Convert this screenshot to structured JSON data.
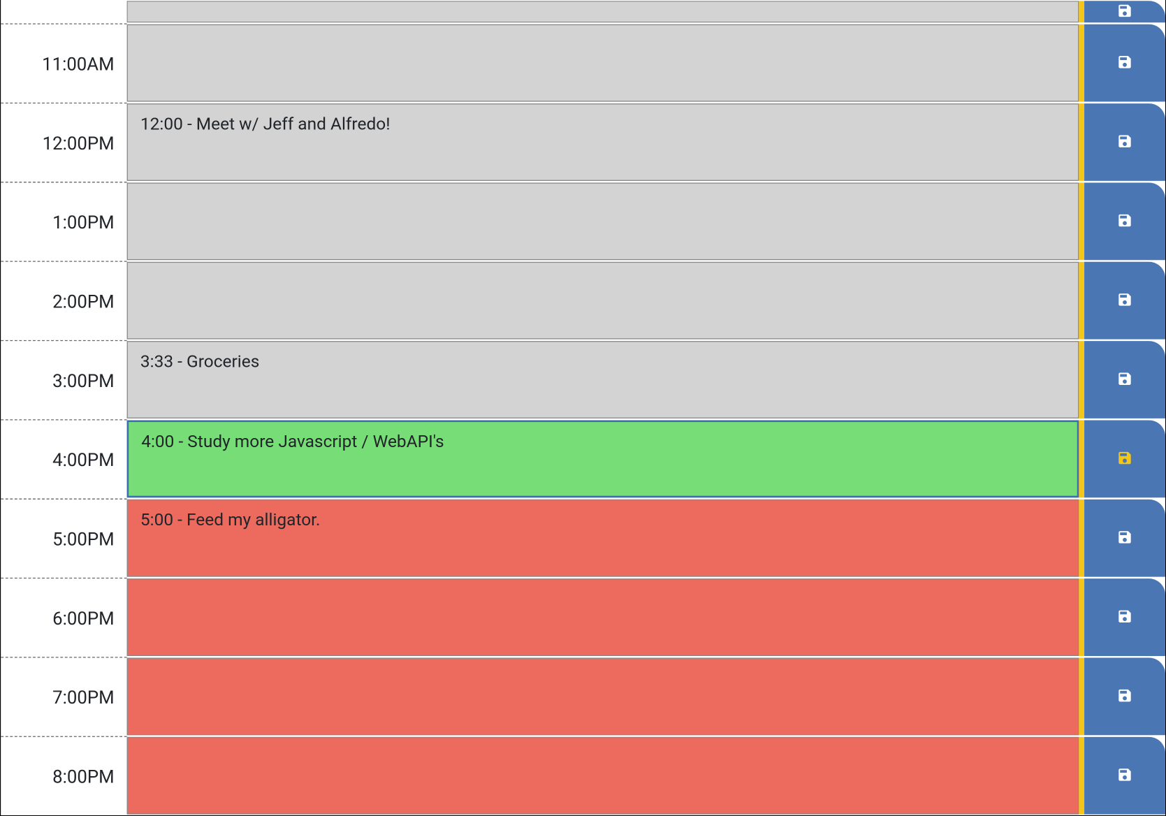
{
  "colors": {
    "past": "#d3d3d3",
    "present": "#77dd77",
    "future": "#ed6a5e",
    "accent": "#f5c518",
    "save_button": "#4a77b4",
    "save_icon": "#ffffff",
    "save_icon_highlight": "#f5c518"
  },
  "hours": [
    {
      "label": "",
      "text": "",
      "state": "past",
      "highlight": false,
      "partial": true
    },
    {
      "label": "11:00AM",
      "text": "",
      "state": "past",
      "highlight": false,
      "partial": false
    },
    {
      "label": "12:00PM",
      "text": "12:00 - Meet w/ Jeff and Alfredo!",
      "state": "past",
      "highlight": false,
      "partial": false
    },
    {
      "label": "1:00PM",
      "text": "",
      "state": "past",
      "highlight": false,
      "partial": false
    },
    {
      "label": "2:00PM",
      "text": "",
      "state": "past",
      "highlight": false,
      "partial": false
    },
    {
      "label": "3:00PM",
      "text": "3:33 - Groceries",
      "state": "past",
      "highlight": false,
      "partial": false
    },
    {
      "label": "4:00PM",
      "text": "4:00 - Study more Javascript / WebAPI's",
      "state": "present",
      "highlight": true,
      "partial": false
    },
    {
      "label": "5:00PM",
      "text": "5:00 - Feed my alligator.",
      "state": "future",
      "highlight": false,
      "partial": false
    },
    {
      "label": "6:00PM",
      "text": "",
      "state": "future",
      "highlight": false,
      "partial": false
    },
    {
      "label": "7:00PM",
      "text": "",
      "state": "future",
      "highlight": false,
      "partial": false
    },
    {
      "label": "8:00PM",
      "text": "",
      "state": "future",
      "highlight": false,
      "partial": false
    }
  ]
}
